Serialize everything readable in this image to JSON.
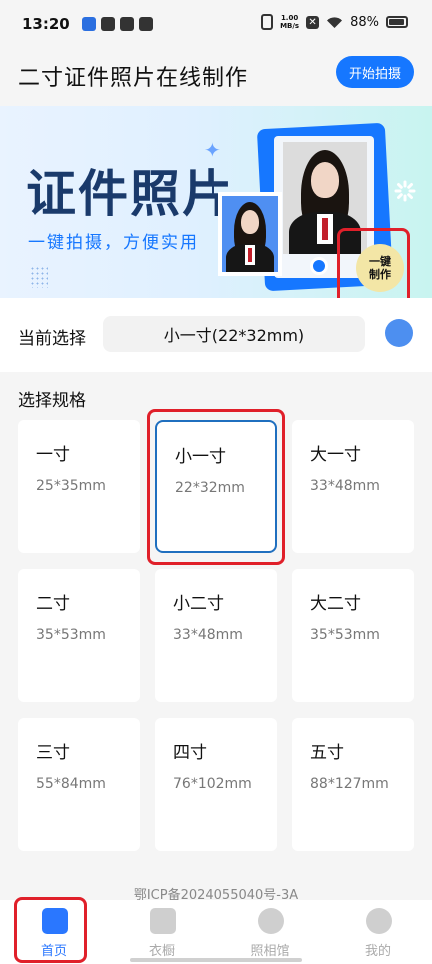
{
  "status_bar": {
    "time": "13:20",
    "net_speed": "1.00\nMB/s",
    "battery": "88%"
  },
  "header": {
    "title": "二寸证件照片在线制作",
    "start_button": "开始拍摄"
  },
  "banner": {
    "title": "证件照片",
    "subtitle": "一键拍摄，方便实用",
    "one_key_badge": "一键\n制作"
  },
  "current_selection": {
    "label": "当前选择",
    "value": "小一寸(22*32mm)"
  },
  "spec_section": {
    "title": "选择规格",
    "items": [
      {
        "name": "一寸",
        "size": "25*35mm"
      },
      {
        "name": "小一寸",
        "size": "22*32mm",
        "selected": true
      },
      {
        "name": "大一寸",
        "size": "33*48mm"
      },
      {
        "name": "二寸",
        "size": "35*53mm"
      },
      {
        "name": "小二寸",
        "size": "33*48mm"
      },
      {
        "name": "大二寸",
        "size": "35*53mm"
      },
      {
        "name": "三寸",
        "size": "55*84mm"
      },
      {
        "name": "四寸",
        "size": "76*102mm"
      },
      {
        "name": "五寸",
        "size": "88*127mm"
      }
    ]
  },
  "footer": {
    "icp": "鄂ICP备2024055040号-3A"
  },
  "tabbar": {
    "items": [
      {
        "label": "首页",
        "icon": "tie-icon",
        "active": true
      },
      {
        "label": "衣橱",
        "icon": "wardrobe-icon"
      },
      {
        "label": "照相馆",
        "icon": "camera-studio-icon"
      },
      {
        "label": "我的",
        "icon": "profile-icon"
      }
    ]
  },
  "colors": {
    "primary": "#1677ff",
    "highlight": "#e0202a",
    "selected_border": "#1f6fbf"
  }
}
